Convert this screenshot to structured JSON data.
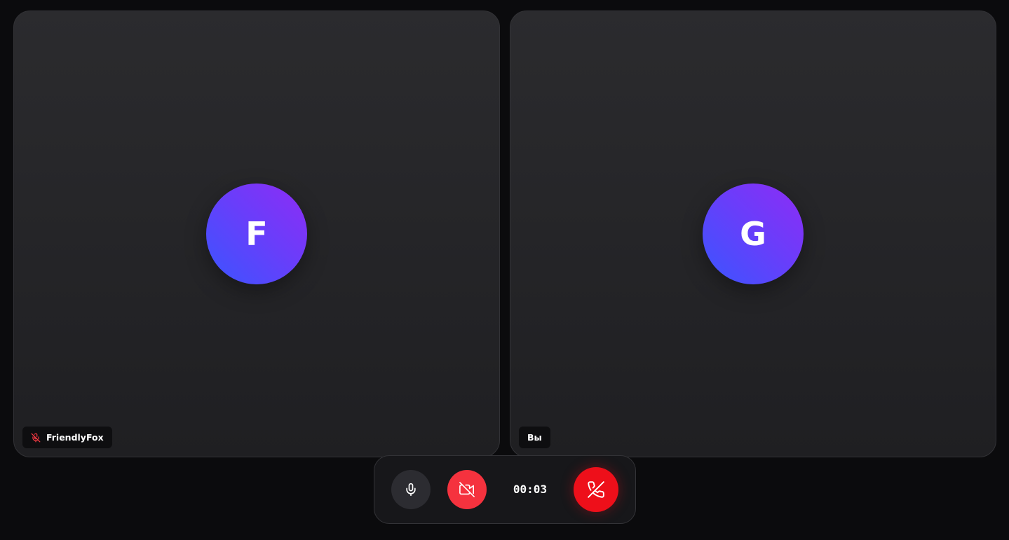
{
  "participants": [
    {
      "initial": "F",
      "name": "FriendlyFox",
      "muted": true,
      "mute_icon": "mic-off-icon"
    },
    {
      "initial": "G",
      "name": "Вы",
      "muted": false
    }
  ],
  "controls": {
    "mic_icon": "mic-icon",
    "camera_icon": "video-off-icon",
    "end_call_icon": "phone-off-icon",
    "timer": "00:03"
  },
  "colors": {
    "background": "#0b0b0d",
    "tile": "#252528",
    "avatar_gradient_start": "#8e2cf5",
    "avatar_gradient_end": "#3a55ff",
    "camera_off": "#f5323e",
    "end_call": "#ee0f1a",
    "muted_indicator": "#ff3b45"
  }
}
